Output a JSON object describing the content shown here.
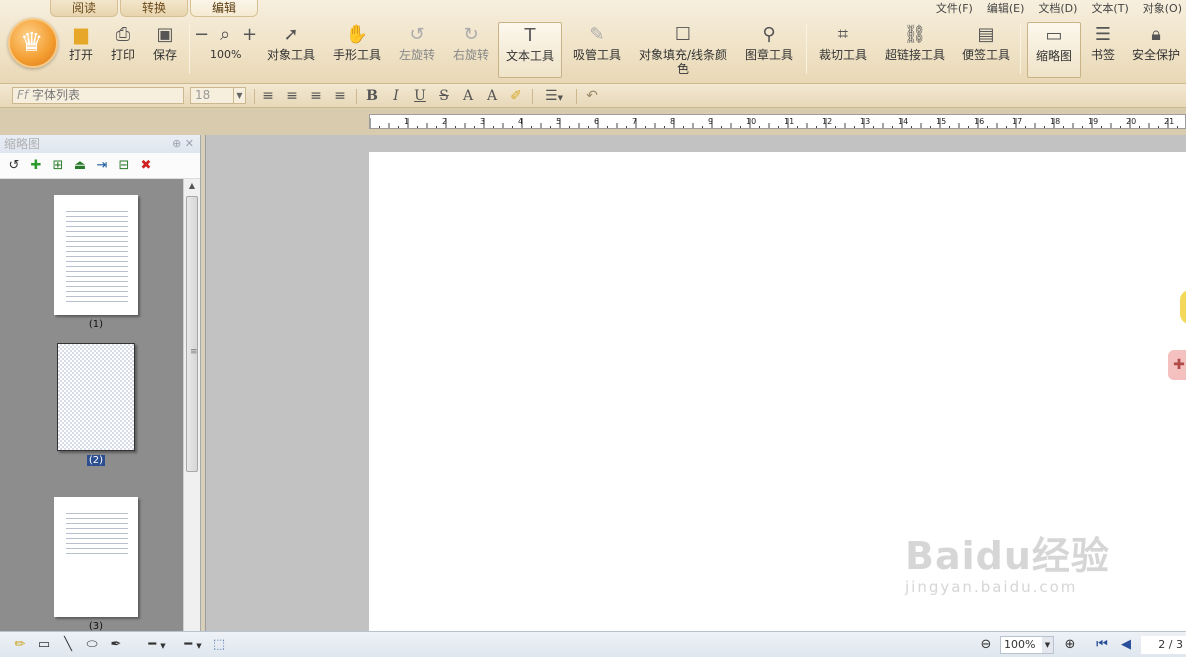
{
  "tabs": [
    "阅读",
    "转换",
    "编辑"
  ],
  "active_tab": 2,
  "menu": [
    "文件(F)",
    "编辑(E)",
    "文档(D)",
    "文本(T)",
    "对象(O)"
  ],
  "toolbar": {
    "open": "打开",
    "print": "打印",
    "save": "保存",
    "zoom_out": "−",
    "zoom_in": "+",
    "zoom": "100%",
    "object_tool": "对象工具",
    "hand_tool": "手形工具",
    "rotate_left": "左旋转",
    "rotate_right": "右旋转",
    "text_tool": "文本工具",
    "eyedropper_tool": "吸管工具",
    "fill_tool": "对象填充/线条颜色",
    "stamp_tool": "图章工具",
    "crop_tool": "裁切工具",
    "hyperlink_tool": "超链接工具",
    "note_tool": "便签工具",
    "thumbnail": "缩略图",
    "bookmark": "书签",
    "security": "安全保护"
  },
  "format": {
    "font_placeholder": "字体列表",
    "font_size": "18",
    "bold": "B",
    "italic": "I",
    "underline": "U",
    "strike": "S",
    "superscript": "A",
    "subscript": "A"
  },
  "ruler_labels": [
    "1",
    "2",
    "3",
    "4",
    "5",
    "6",
    "7",
    "8",
    "9",
    "10",
    "11",
    "12",
    "13",
    "14",
    "15",
    "16",
    "17",
    "18",
    "19",
    "20",
    "21"
  ],
  "thumb_panel": {
    "title": "缩略图",
    "pages": [
      "(1)",
      "(2)",
      "(3)"
    ],
    "selected": 1
  },
  "watermark": {
    "brand": "Baidu经验",
    "url": "jingyan.baidu.com"
  },
  "status": {
    "zoom": "100%",
    "page": "2 / 3"
  }
}
